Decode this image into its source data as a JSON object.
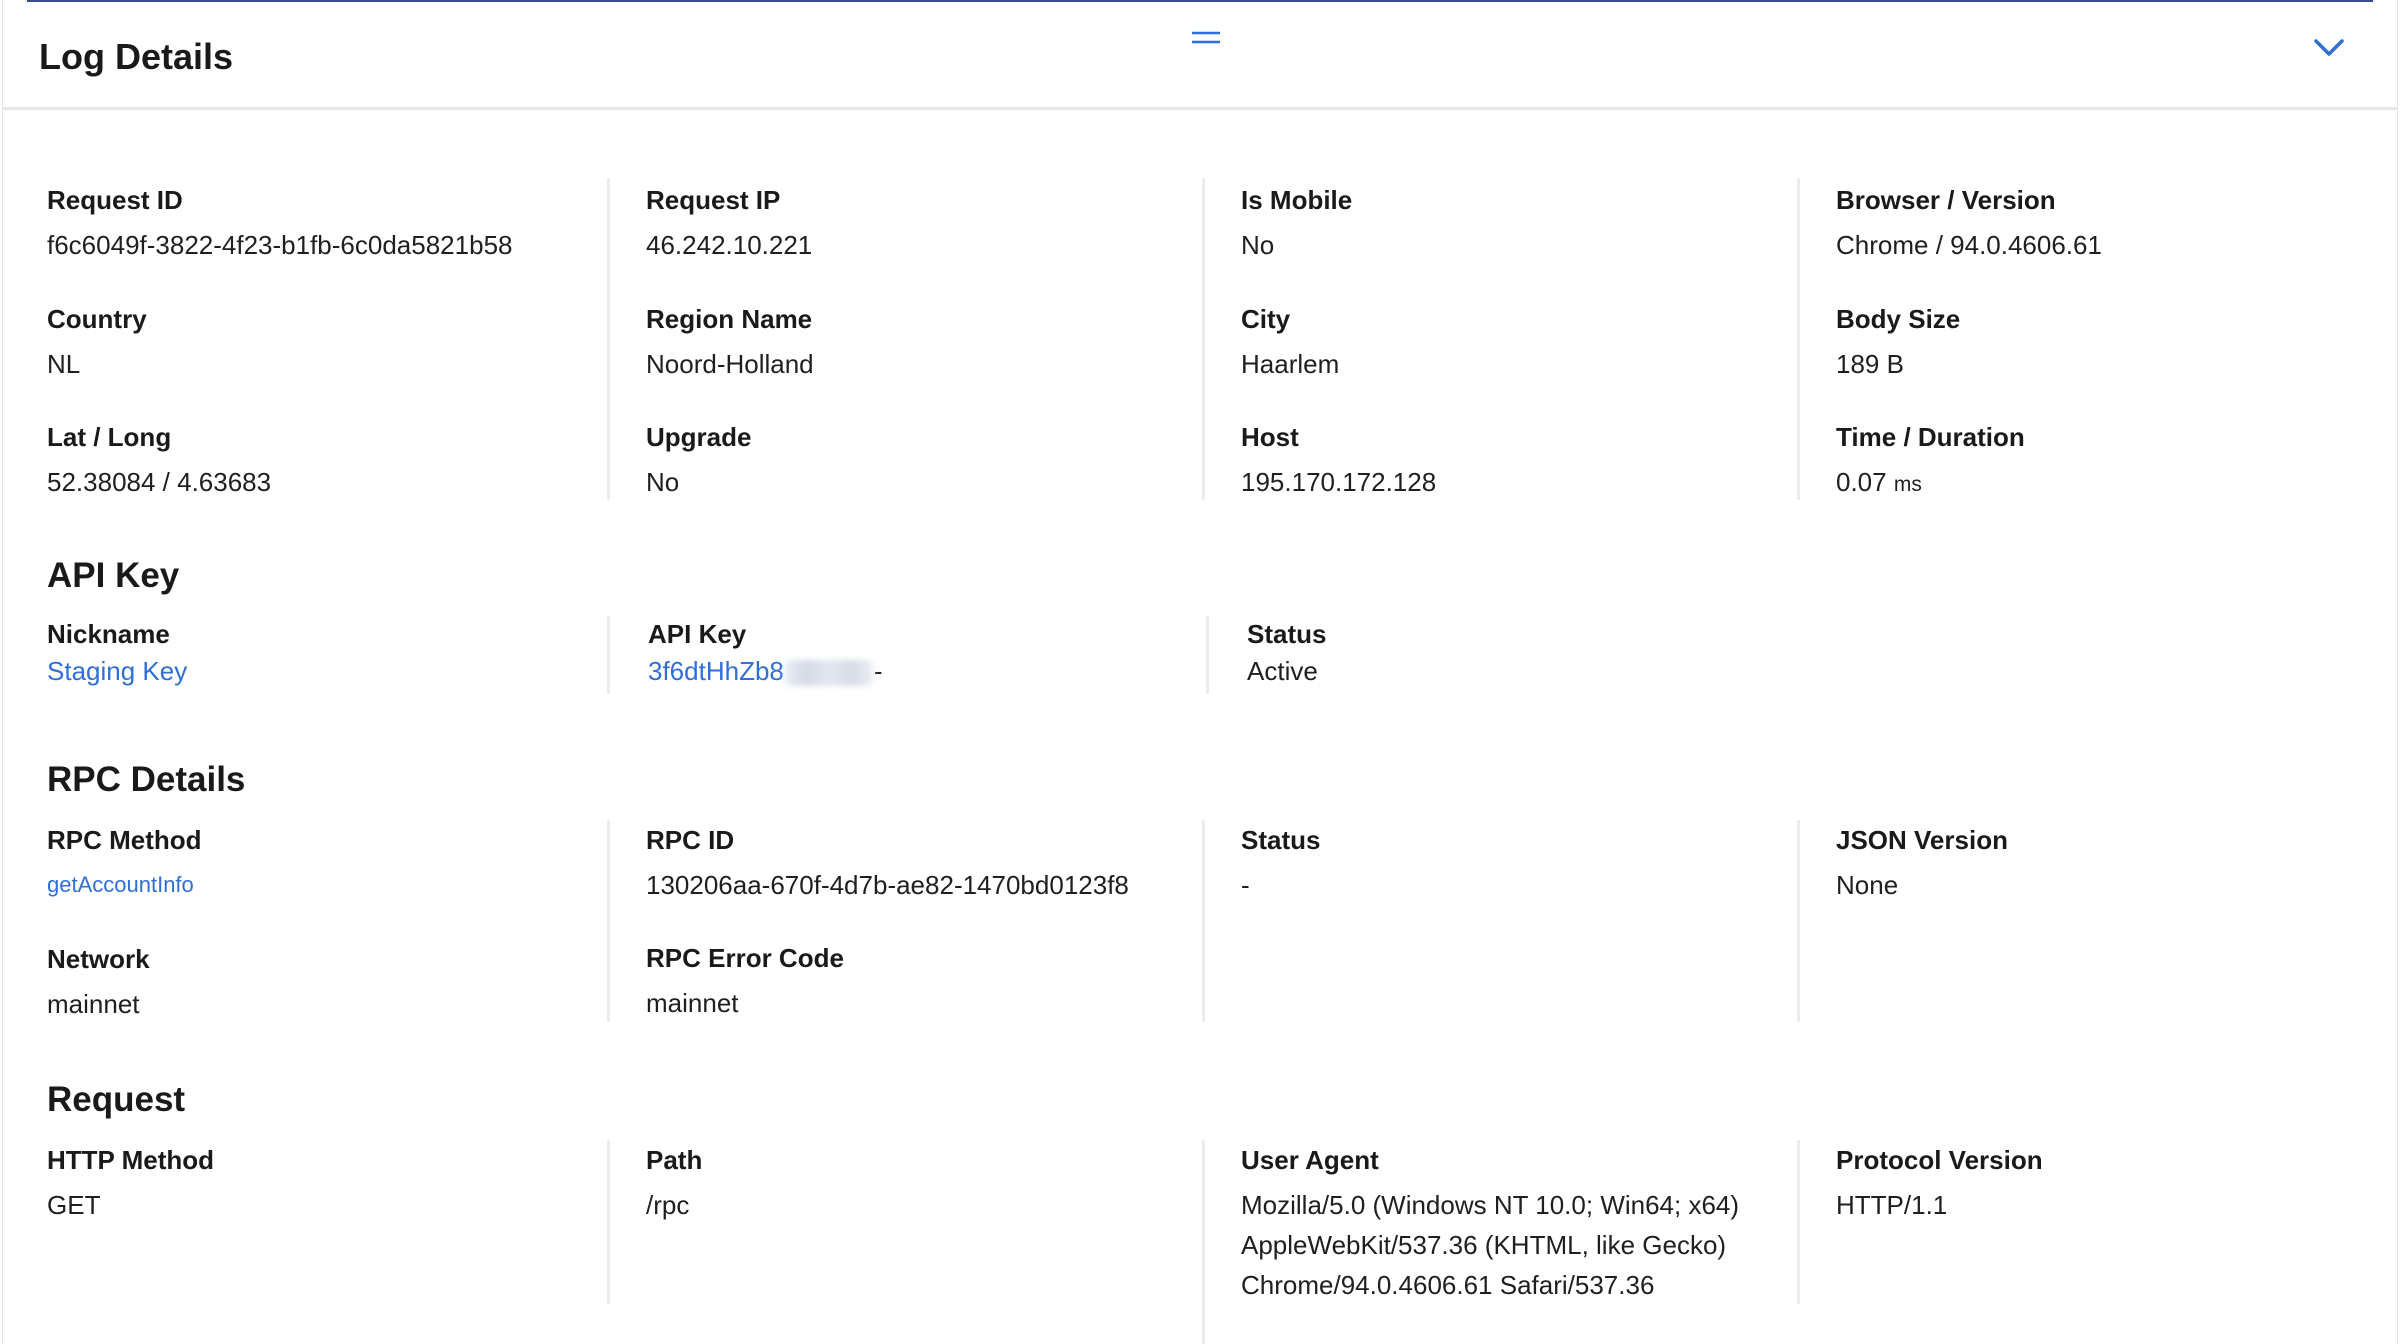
{
  "header": {
    "title": "Log Details"
  },
  "overview": {
    "request_id": {
      "label": "Request ID",
      "value": "f6c6049f-3822-4f23-b1fb-6c0da5821b58"
    },
    "request_ip": {
      "label": "Request IP",
      "value": "46.242.10.221"
    },
    "is_mobile": {
      "label": "Is Mobile",
      "value": "No"
    },
    "browser": {
      "label": "Browser / Version",
      "value": "Chrome / 94.0.4606.61"
    },
    "country": {
      "label": "Country",
      "value": "NL"
    },
    "region": {
      "label": "Region Name",
      "value": "Noord-Holland"
    },
    "city": {
      "label": "City",
      "value": "Haarlem"
    },
    "body_size": {
      "label": "Body Size",
      "value": "189 B"
    },
    "lat_long": {
      "label": "Lat / Long",
      "value": "52.38084 / 4.63683"
    },
    "upgrade": {
      "label": "Upgrade",
      "value": "No"
    },
    "host": {
      "label": "Host",
      "value": "195.170.172.128"
    },
    "time": {
      "label": "Time / Duration",
      "value": "0.07",
      "unit": "ms"
    }
  },
  "api_key": {
    "title": "API Key",
    "nickname": {
      "label": "Nickname",
      "value": "Staging Key"
    },
    "key": {
      "label": "API Key",
      "value_prefix": "3f6dtHhZb8",
      "value_suffix": "-"
    },
    "status": {
      "label": "Status",
      "value": "Active"
    }
  },
  "rpc": {
    "title": "RPC Details",
    "method": {
      "label": "RPC Method",
      "value": "getAccountInfo"
    },
    "id": {
      "label": "RPC ID",
      "value": "130206aa-670f-4d7b-ae82-1470bd0123f8"
    },
    "status": {
      "label": "Status",
      "value": "-"
    },
    "json_version": {
      "label": "JSON Version",
      "value": "None"
    },
    "network": {
      "label": "Network",
      "value": "mainnet"
    },
    "error_code": {
      "label": "RPC Error Code",
      "value": "mainnet"
    }
  },
  "request": {
    "title": "Request",
    "http_method": {
      "label": "HTTP Method",
      "value": "GET"
    },
    "path": {
      "label": "Path",
      "value": "/rpc"
    },
    "user_agent": {
      "label": "User Agent",
      "lines": [
        "Mozilla/5.0 (Windows NT 10.0; Win64; x64)",
        "AppleWebKit/537.36 (KHTML, like Gecko)",
        "Chrome/94.0.4606.61 Safari/537.36"
      ]
    },
    "protocol": {
      "label": "Protocol Version",
      "value": "HTTP/1.1"
    }
  },
  "colors": {
    "accent_link": "#2f6fd6",
    "top_border": "#3d4c8f",
    "separator": "#ececec"
  },
  "icons": {
    "drag": "drag-handle-icon",
    "collapse": "chevron-down-icon"
  }
}
